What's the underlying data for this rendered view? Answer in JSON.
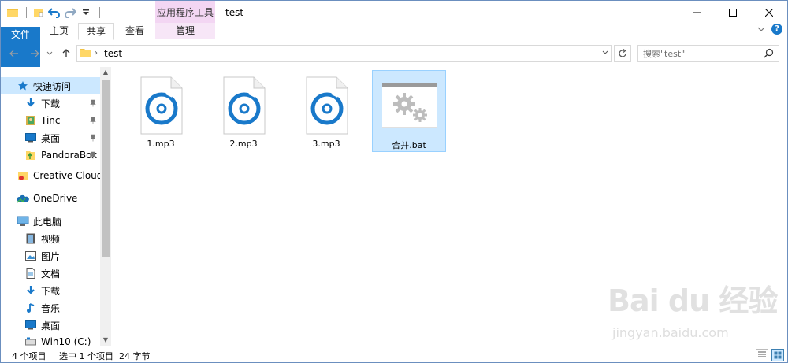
{
  "window": {
    "title": "test",
    "context_group": "应用程序工具"
  },
  "ribbon": {
    "tabs": {
      "file": "文件",
      "home": "主页",
      "share": "共享",
      "view": "查看",
      "manage": "管理"
    }
  },
  "address": {
    "path": "test",
    "search_placeholder": "搜索\"test\""
  },
  "nav": {
    "items": [
      {
        "label": "快速访问",
        "icon": "star-icon"
      },
      {
        "label": "下载",
        "icon": "download-arrow-icon"
      },
      {
        "label": "Tinc",
        "icon": "folder-image-icon"
      },
      {
        "label": "桌面",
        "icon": "desktop-icon"
      },
      {
        "label": "PandoraBox",
        "icon": "folder-green-icon"
      },
      {
        "label": "Creative Cloud F",
        "icon": "creative-cloud-icon"
      },
      {
        "label": "OneDrive",
        "icon": "onedrive-icon"
      },
      {
        "label": "此电脑",
        "icon": "computer-icon"
      },
      {
        "label": "视频",
        "icon": "video-icon"
      },
      {
        "label": "图片",
        "icon": "pictures-icon"
      },
      {
        "label": "文档",
        "icon": "documents-icon"
      },
      {
        "label": "下载",
        "icon": "download-arrow-icon"
      },
      {
        "label": "音乐",
        "icon": "music-icon"
      },
      {
        "label": "桌面",
        "icon": "desktop-icon"
      },
      {
        "label": "Win10 (C:)",
        "icon": "drive-icon"
      }
    ]
  },
  "files": [
    {
      "name": "1.mp3",
      "icon": "music-disc-icon"
    },
    {
      "name": "2.mp3",
      "icon": "music-disc-icon"
    },
    {
      "name": "3.mp3",
      "icon": "music-disc-icon"
    },
    {
      "name": "合并.bat",
      "icon": "batch-gears-icon",
      "selected": true
    }
  ],
  "status": {
    "count": "4 个项目",
    "selected": "选中 1 个项目",
    "size": "24 字节"
  },
  "watermark": {
    "brand": "Bai du 经验",
    "url": "jingyan.baidu.com"
  },
  "colors": {
    "accent": "#1979ca",
    "selection": "#cce8ff",
    "context_tab": "#f3d6f3"
  }
}
